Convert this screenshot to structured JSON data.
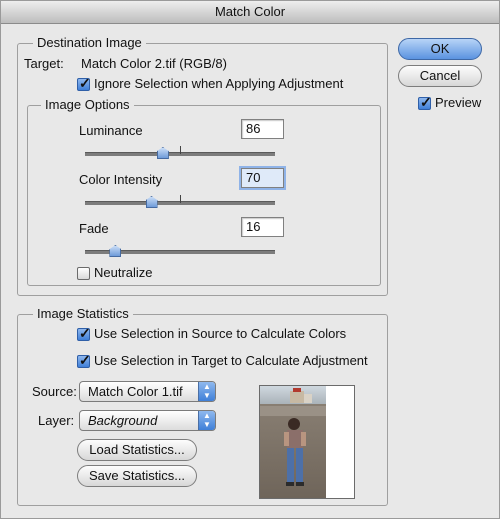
{
  "window": {
    "title": "Match Color"
  },
  "buttons": {
    "ok": "OK",
    "cancel": "Cancel"
  },
  "preview": {
    "label": "Preview",
    "checked": true
  },
  "destination": {
    "legend": "Destination Image",
    "target_label": "Target:",
    "target_value": "Match Color 2.tif (RGB/8)",
    "ignore_selection": "Ignore Selection when Applying Adjustment",
    "ignore_checked": true
  },
  "options": {
    "legend": "Image Options",
    "luminance_label": "Luminance",
    "luminance_value": "86",
    "luminance_level": 0.41,
    "intensity_label": "Color Intensity",
    "intensity_value": "70",
    "intensity_level": 0.35,
    "fade_label": "Fade",
    "fade_value": "16",
    "fade_level": 0.16,
    "neutralize_label": "Neutralize",
    "neutralize_checked": false
  },
  "statistics": {
    "legend": "Image Statistics",
    "use_source": "Use Selection in Source to Calculate Colors",
    "use_source_checked": true,
    "use_target": "Use Selection in Target to Calculate Adjustment",
    "use_target_checked": true,
    "source_label": "Source:",
    "source_value": "Match Color 1.tif",
    "layer_label": "Layer:",
    "layer_value": "Background",
    "load_button": "Load Statistics...",
    "save_button": "Save Statistics..."
  }
}
